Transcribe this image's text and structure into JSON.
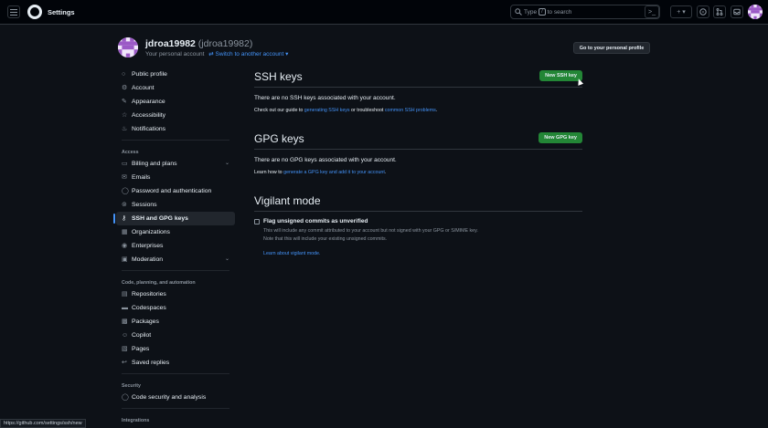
{
  "header": {
    "title": "Settings",
    "search_prefix": "Type",
    "search_key": "/",
    "search_suffix": "to search"
  },
  "profile": {
    "display_name": "jdroa19982",
    "login": "(jdroa19982)",
    "account_label": "Your personal account",
    "switch_label": "Switch to another account",
    "profile_button": "Go to your personal profile"
  },
  "nav": {
    "top": [
      "Public profile",
      "Account",
      "Appearance",
      "Accessibility",
      "Notifications"
    ],
    "access_header": "Access",
    "access": [
      "Billing and plans",
      "Emails",
      "Password and authentication",
      "Sessions",
      "SSH and GPG keys",
      "Organizations",
      "Enterprises",
      "Moderation"
    ],
    "code_header": "Code, planning, and automation",
    "code": [
      "Repositories",
      "Codespaces",
      "Packages",
      "Copilot",
      "Pages",
      "Saved replies"
    ],
    "security_header": "Security",
    "security": [
      "Code security and analysis"
    ],
    "integrations_header": "Integrations"
  },
  "ssh": {
    "title": "SSH keys",
    "button": "New SSH key",
    "message": "There are no SSH keys associated with your account.",
    "help_pre": "Check out our guide to",
    "help_link1": "generating SSH keys",
    "help_mid": "or troubleshoot",
    "help_link2": "common SSH problems",
    "help_end": "."
  },
  "gpg": {
    "title": "GPG keys",
    "button": "New GPG key",
    "message": "There are no GPG keys associated with your account.",
    "help_pre": "Learn how to",
    "help_link": "generate a GPG key and add it to your account",
    "help_end": "."
  },
  "vigilant": {
    "title": "Vigilant mode",
    "checkbox_label": "Flag unsigned commits as unverified",
    "note_line1": "This will include any commit attributed to your account but not signed with your GPG or S/MIME key.",
    "note_line2": "Note that this will include your existing unsigned commits.",
    "learn_link": "Learn about vigilant mode."
  },
  "status_url": "https://github.com/settings/ssh/new"
}
